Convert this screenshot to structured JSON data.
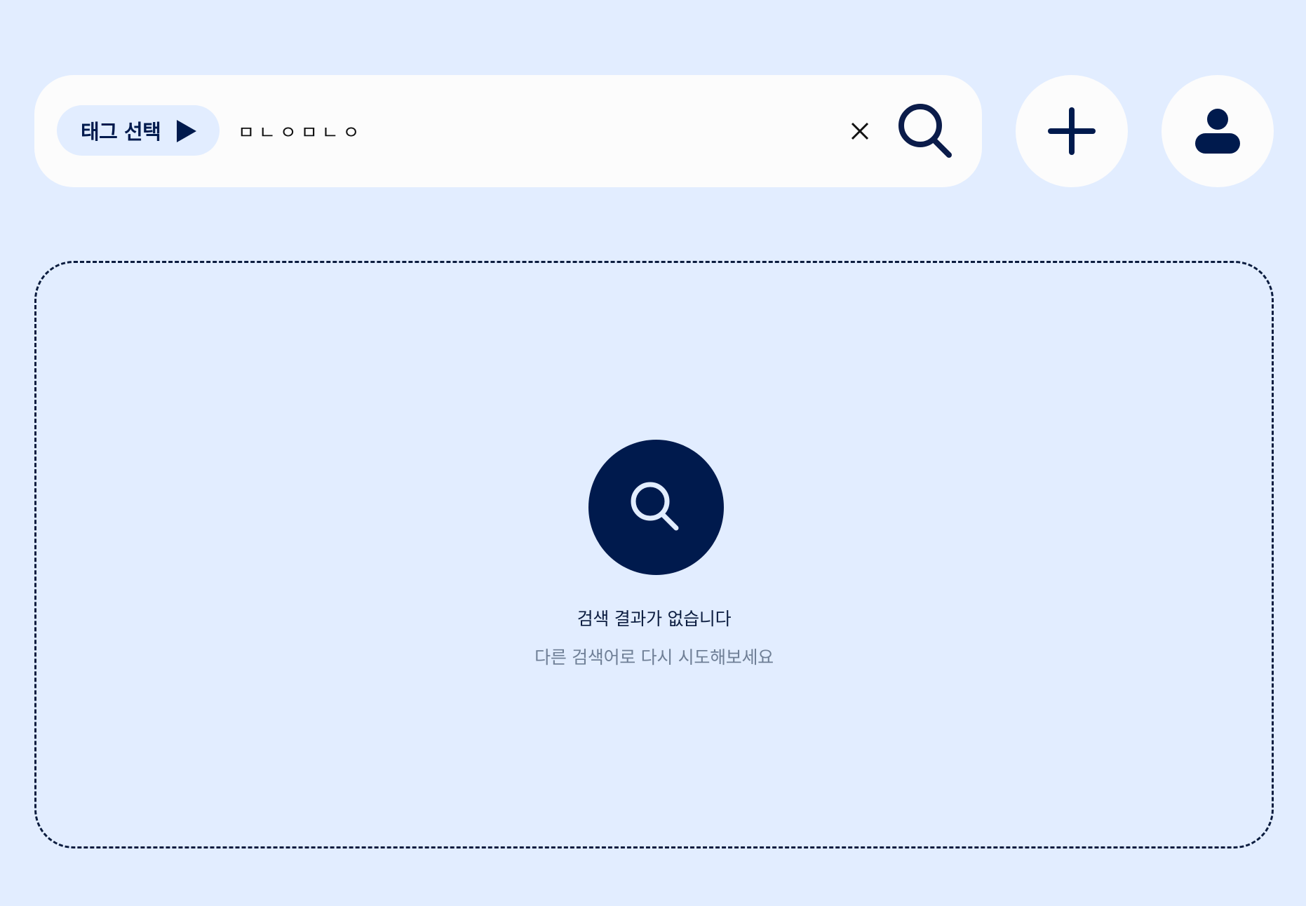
{
  "search": {
    "tag_button_label": "태그 선택",
    "query": "ㅁㄴㅇㅁㄴㅇ",
    "clear_icon": "close-icon",
    "search_icon": "search-icon"
  },
  "actions": {
    "add_icon": "plus-icon",
    "profile_icon": "user-icon"
  },
  "empty_state": {
    "icon": "search-icon",
    "title": "검색 결과가 없습니다",
    "subtitle": "다른 검색어로 다시 시도해보세요"
  },
  "colors": {
    "background": "#e2edff",
    "surface": "#fcfcfc",
    "primary": "#001a4d",
    "muted_text": "#6f7f96"
  }
}
